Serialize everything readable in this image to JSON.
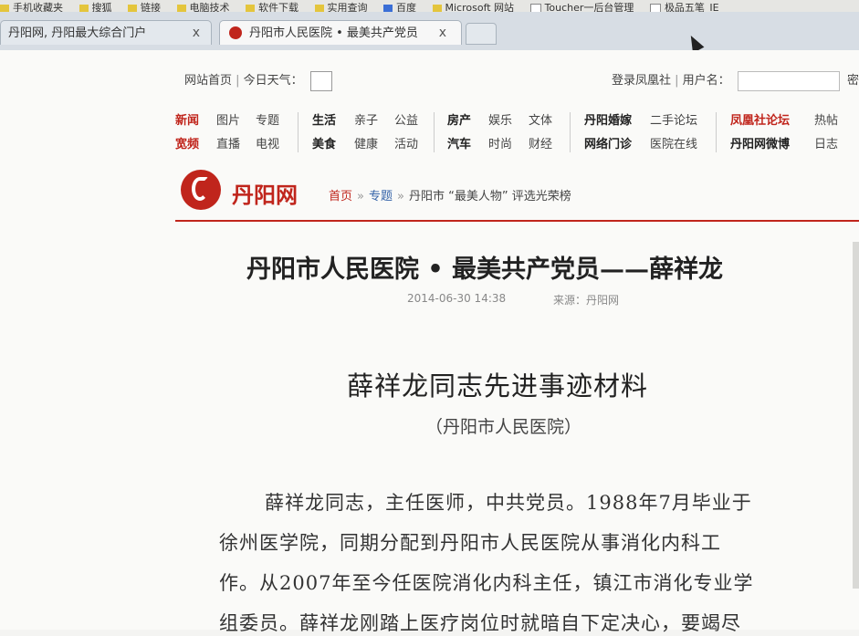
{
  "bookmarks": [
    "手机收藏夹",
    "搜狐",
    "链接",
    "电脑技术",
    "软件下载",
    "实用查询",
    "百度",
    "Microsoft 网站",
    "Toucher一后台管理",
    "极品五笔_IE"
  ],
  "tabs": [
    {
      "title": "丹阳网, 丹阳最大综合门户",
      "close": "x"
    },
    {
      "title": "丹阳市人民医院 • 最美共产党员",
      "close": "x"
    }
  ],
  "topbar": {
    "home": "网站首页",
    "weather": "今日天气：",
    "login": "登录凤凰社",
    "username": "用户名：",
    "password_cut": "密"
  },
  "nav": {
    "row1": [
      "新闻",
      "图片",
      "专题",
      "生活",
      "亲子",
      "公益",
      "房产",
      "娱乐",
      "文体",
      "丹阳婚嫁",
      "二手论坛",
      "凤凰社论坛",
      "热帖"
    ],
    "row2": [
      "宽频",
      "直播",
      "电视",
      "美食",
      "健康",
      "活动",
      "汽车",
      "时尚",
      "财经",
      "网络门诊",
      "医院在线",
      "丹阳网微博",
      "日志"
    ]
  },
  "logo": {
    "text": "丹阳网"
  },
  "breadcrumb": {
    "home": "首页",
    "topic": "专题",
    "current": "丹阳市 “最美人物” 评选光荣榜",
    "sep": "»"
  },
  "article": {
    "title": "丹阳市人民医院 • 最美共产党员——薛祥龙",
    "date": "2014-06-30 14:38",
    "source": "来源：丹阳网",
    "heading": "薛祥龙同志先进事迹材料",
    "subheading": "（丹阳市人民医院）",
    "paragraph_lines": [
      "薛祥龙同志，主任医师，中共党员。1988年7月毕业于",
      "徐州医学院，同期分配到丹阳市人民医院从事消化内科工",
      "作。从2007年至今任医院消化内科主任，镇江市消化专业学",
      "组委员。薛祥龙刚踏上医疗岗位时就暗自下定决心，要竭尽"
    ]
  }
}
